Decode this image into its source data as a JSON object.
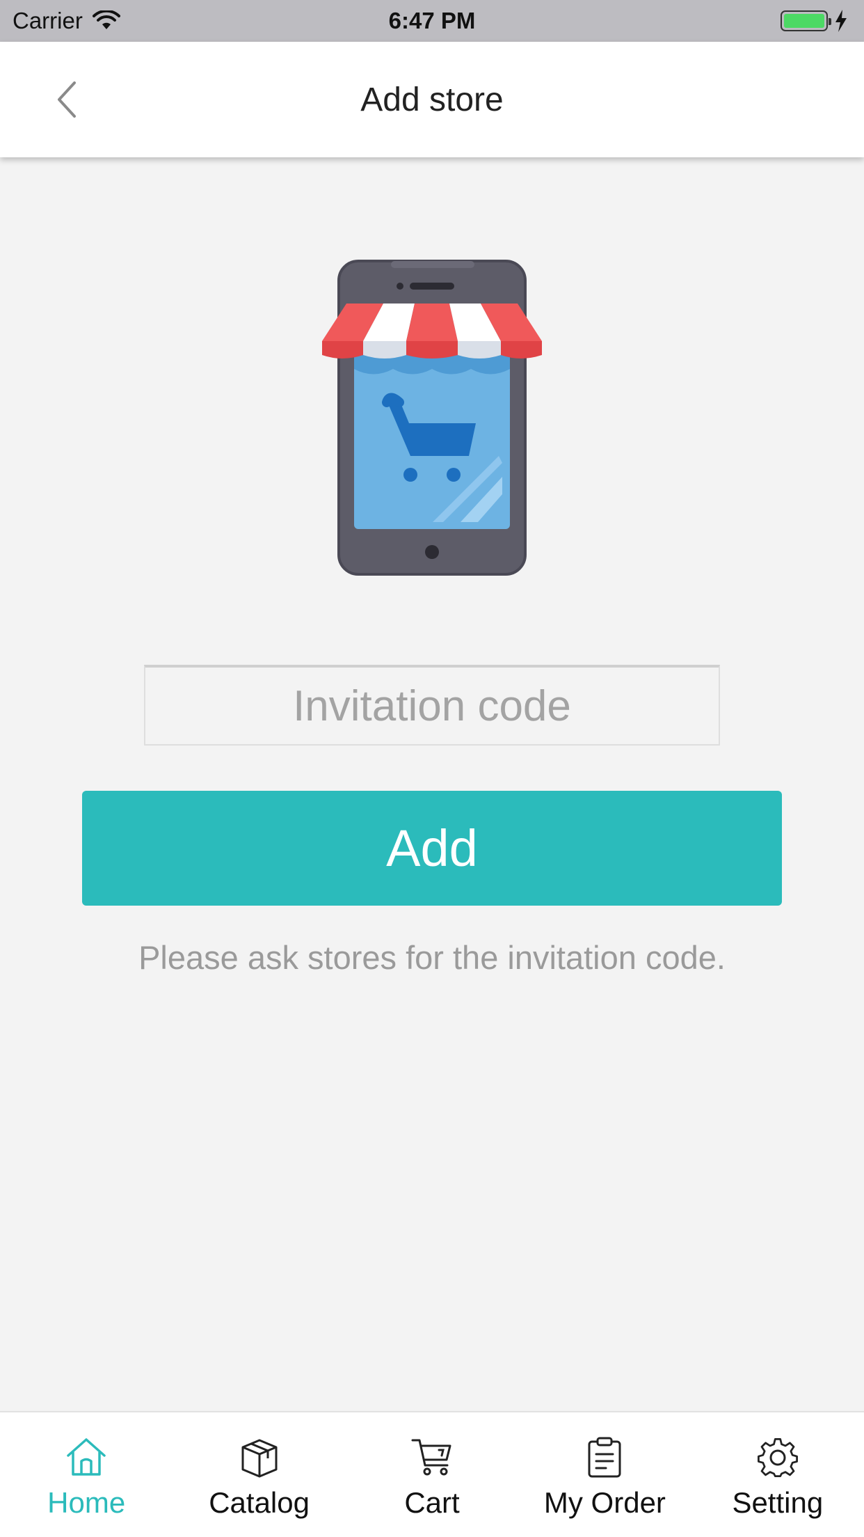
{
  "status_bar": {
    "carrier": "Carrier",
    "time": "6:47 PM"
  },
  "nav": {
    "title": "Add store",
    "back_icon": "chevron-left-icon"
  },
  "illustration": {
    "icon": "mobile-store-icon"
  },
  "form": {
    "invitation_placeholder": "Invitation code",
    "invitation_value": "",
    "add_label": "Add",
    "hint": "Please ask stores for the invitation code."
  },
  "tab_bar": {
    "accent_color": "#2bbbbb",
    "active_index": 0,
    "tabs": [
      {
        "label": "Home",
        "icon": "home-icon"
      },
      {
        "label": "Catalog",
        "icon": "box-icon"
      },
      {
        "label": "Cart",
        "icon": "cart-icon"
      },
      {
        "label": "My Order",
        "icon": "clipboard-icon"
      },
      {
        "label": "Setting",
        "icon": "gear-icon"
      }
    ]
  }
}
